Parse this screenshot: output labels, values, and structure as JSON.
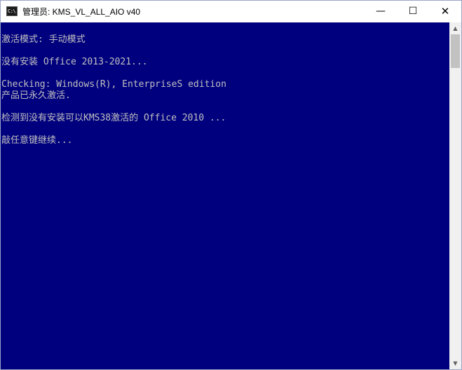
{
  "window": {
    "title": "管理员:  KMS_VL_ALL_AIO v40",
    "icon": "cmd-console-icon",
    "icon_glyph": "C:\\",
    "controls": {
      "minimize": "—",
      "maximize": "☐",
      "close": "✕"
    }
  },
  "console": {
    "colors": {
      "background": "#00007f",
      "text": "#c0c0c0"
    },
    "lines": [
      "激活模式: 手动模式",
      "没有安装 Office 2013-2021...",
      "Checking: Windows(R), EnterpriseS edition",
      "产品已永久激活.",
      "检测到没有安装可以KMS38激活的 Office 2010 ...",
      "敲任意键继续..."
    ]
  },
  "scrollbar": {
    "up": "▲",
    "down": "▼"
  }
}
